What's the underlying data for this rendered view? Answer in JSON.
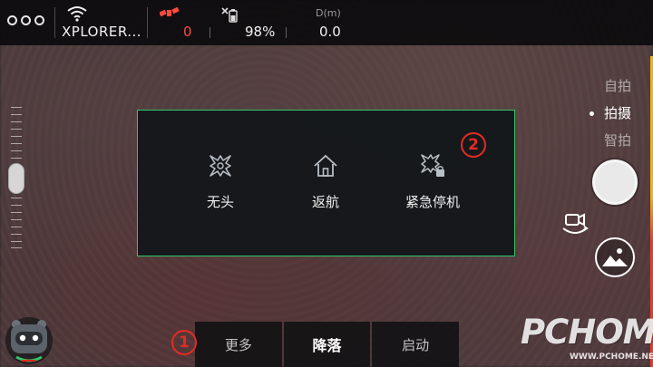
{
  "status_bar": {
    "menu_icon": "more-dots-icon",
    "network_name": "XPLORER...",
    "satellite_count": "0",
    "battery_percent": "98%",
    "distance_label": "D(m)",
    "distance_value": "0.0"
  },
  "camera_modes": {
    "items": [
      "自拍",
      "拍摄",
      "智拍"
    ],
    "active": "拍摄"
  },
  "modal": {
    "items": [
      {
        "label": "无头",
        "icon": "headless-drone-icon"
      },
      {
        "label": "返航",
        "icon": "home-icon"
      },
      {
        "label": "紧急停机",
        "icon": "emergency-stop-drone-icon"
      }
    ]
  },
  "bottom_bar": {
    "more_label": "更多",
    "land_label": "降落",
    "start_label": "启动"
  },
  "annotations": {
    "marker_1": "1",
    "marker_2": "2"
  },
  "watermark": {
    "main": "PCHOME",
    "sub": "WWW.PCHOME.NET"
  },
  "colors": {
    "accent_green": "#35c46a",
    "alert_red": "#ff4a3d",
    "annotation_red": "#e52b23"
  }
}
